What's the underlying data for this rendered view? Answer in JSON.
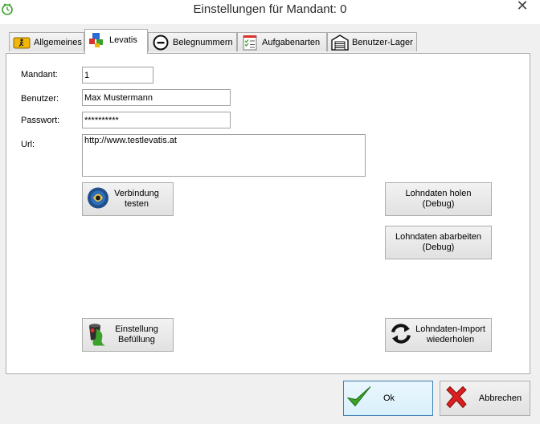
{
  "window": {
    "title": "Einstellungen für Mandant: 0",
    "close_glyph": "✕"
  },
  "tabs": [
    {
      "label": "Allgemeines",
      "icon": "running-man-sign-icon"
    },
    {
      "label": "Levatis",
      "icon": "puzzle-pieces-icon"
    },
    {
      "label": "Belegnummern",
      "icon": "minus-circle-icon"
    },
    {
      "label": "Aufgabenarten",
      "icon": "checklist-icon"
    },
    {
      "label": "Benutzer-Lager",
      "icon": "warehouse-icon"
    }
  ],
  "active_tab": "Levatis",
  "form": {
    "mandant_label": "Mandant:",
    "mandant_value": "1",
    "benutzer_label": "Benutzer:",
    "benutzer_value": "Max Mustermann",
    "passwort_label": "Passwort:",
    "passwort_value": "**********",
    "url_label": "Url:",
    "url_value": "http://www.testlevatis.at"
  },
  "buttons": {
    "verbindung_testen": "Verbindung\ntesten",
    "lohndaten_holen": "Lohndaten holen\n(Debug)",
    "lohndaten_abarbeiten": "Lohndaten abarbeiten\n(Debug)",
    "einstellung_befuellung": "Einstellung\nBefüllung",
    "lohndaten_import": "Lohndaten-Import\nwiederholen",
    "ok": "Ok",
    "abbrechen": "Abbrechen"
  },
  "colors": {
    "accent_green": "#3aa12a",
    "cancel_red": "#d81e1e",
    "ok_border": "#3c7fb1"
  }
}
